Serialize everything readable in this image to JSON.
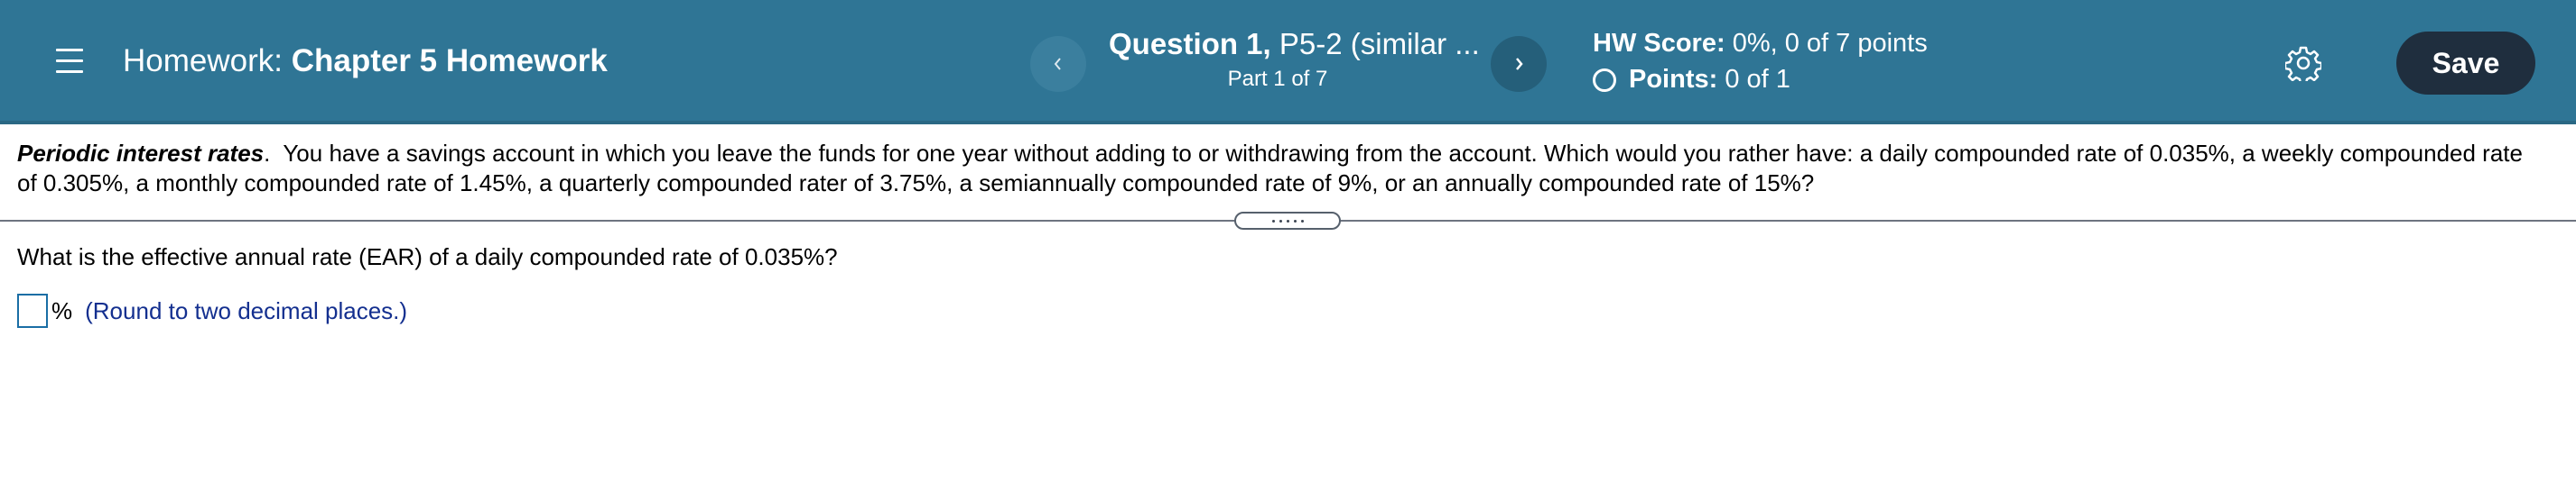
{
  "header": {
    "title_prefix": "Homework:",
    "title": "Chapter 5 Homework",
    "question_label": "Question 1,",
    "question_name": "P5-2 (similar ...",
    "part": "Part 1 of 7",
    "hw_score_label": "HW Score:",
    "hw_score_value": "0%, 0 of 7 points",
    "points_label": "Points:",
    "points_value": "0 of 1",
    "save_label": "Save",
    "prev_icon": "chevron-left-icon",
    "next_icon": "chevron-right-icon",
    "settings_icon": "gear-icon",
    "colors": {
      "bar": "#2f7595",
      "save": "#1f2e3e",
      "hint": "#132f8f"
    }
  },
  "problem": {
    "heading": "Periodic interest rates",
    "heading_punct": ".",
    "text_line1": "You have a savings account in which you leave the funds for one year without adding to or withdrawing from the account.  Which would you rather have:  a daily compounded rate of 0.035%, a weekly compounded rate",
    "text_line2": "of 0.305%, a monthly compounded rate of 1.45%, a quarterly compounded rater of 3.75%, a semiannually compounded rate of 9%, or an annually compounded rate of 15%?"
  },
  "part1": {
    "question": "What is the effective annual rate (EAR) of a daily compounded rate of 0.035%?",
    "answer_value": "",
    "unit": "%",
    "hint": "(Round to two decimal places.)"
  }
}
